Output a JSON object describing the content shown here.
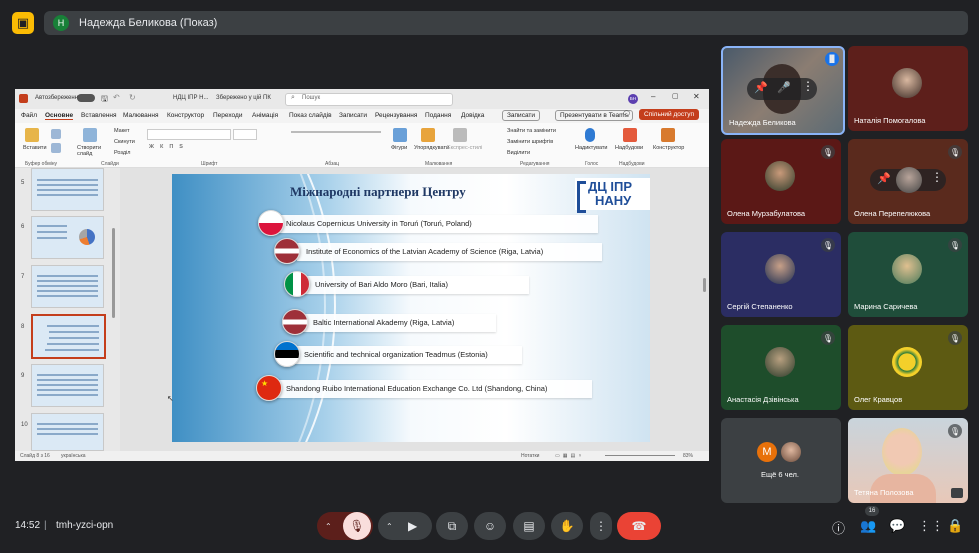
{
  "top_bar": {
    "presenter_initial": "Н",
    "presenter_name": "Надежда Беликова (Показ)"
  },
  "app": {
    "autosave_label": "Автозбереження",
    "file_name": "НДЦ ІПР Н...",
    "save_status": "Збережено у цій ПК",
    "search_placeholder": "Пошук",
    "user_initials": "БН",
    "ribbon_tabs": [
      "Файл",
      "Основне",
      "Вставлення",
      "Малювання",
      "Конструктор",
      "Переходи",
      "Анімація",
      "Показ слайдів",
      "Записати",
      "Рецензування",
      "Подання",
      "Довідка"
    ],
    "record_button": "Записати",
    "teams_button": "Презентувати в Teams",
    "share_button": "Спільний доступ",
    "ribbon_labels": {
      "paste": "Вставити",
      "new_slide": "Створити слайд",
      "layout": "Макет",
      "reset": "Скинути",
      "section": "Розділ",
      "shapes": "Фігури",
      "arrange": "Упорядкувати",
      "quick_styles": "Експрес-стилі",
      "find_replace": "Знайти та замінити",
      "replace_fonts": "Замінити шрифтів",
      "select": "Виділити",
      "dictate": "Надиктувати",
      "addins": "Надбудови",
      "designer": "Конструктор"
    },
    "ribbon_groups": [
      "Буфер обміну",
      "Слайди",
      "Шрифт",
      "Абзац",
      "Малювання",
      "Редагування",
      "Голос",
      "Надбудови"
    ],
    "slide_numbers": [
      "5",
      "6",
      "7",
      "8",
      "9",
      "10"
    ],
    "slide_title": "Міжнародні партнери Центру",
    "logo_line1": "ДЦ ІПР",
    "logo_line2": "НАНУ",
    "partners": [
      "Nicolaus Copernicus University in Toruń (Toruń, Poland)",
      "Institute of Economics of the Latvian Academy of Science (Riga, Latvia)",
      "University of Bari Aldo Moro (Bari, Italia)",
      "Baltic International Akademy (Riga, Latvia)",
      "Scientific and technical organization Teadmus (Estonia)",
      "Shandong Ruibo International Education Exchange Co. Ltd (Shandong, China)"
    ],
    "status_slide": "Слайд 8 з 16",
    "status_lang": "українська",
    "status_notes": "Нотатки",
    "status_zoom": "83%"
  },
  "participants": [
    {
      "name": "Надежда Беликова"
    },
    {
      "name": "Наталія Помогалова"
    },
    {
      "name": "Олена Мурзабулатова"
    },
    {
      "name": "Олена Перепелюкова"
    },
    {
      "name": "Сергій Степаненко"
    },
    {
      "name": "Марина Саричева"
    },
    {
      "name": "Анастасія Дзівінська"
    },
    {
      "name": "Олег Кравцов"
    },
    {
      "name": "Ещё 6 чел.",
      "initial": "M"
    },
    {
      "name": "Тетяна Полозова"
    }
  ],
  "bottom_bar": {
    "time": "14:52",
    "separator": "|",
    "meeting_code": "tmh-yzci-opn",
    "participant_count": "16"
  },
  "colors": {
    "end_call": "#ea4335",
    "mic_off": "#f9dedc",
    "accent": "#8ab4f8"
  }
}
